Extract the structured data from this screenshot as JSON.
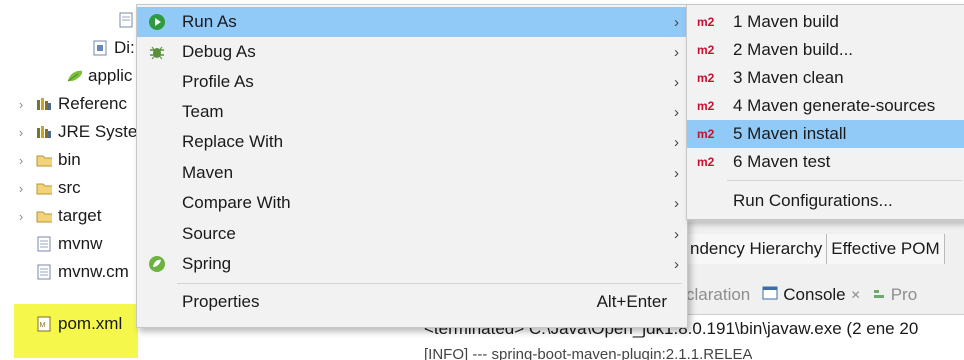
{
  "explorer": {
    "items": [
      {
        "label": "",
        "icon": "file-icon",
        "twisty": ""
      },
      {
        "label": "Di:",
        "icon": "class-file-icon",
        "twisty": ""
      },
      {
        "label": "applic",
        "icon": "leaf-icon",
        "twisty": ""
      },
      {
        "label": "Referenc",
        "icon": "library-icon",
        "twisty": "›"
      },
      {
        "label": "JRE Syste",
        "icon": "library-icon",
        "twisty": "›"
      },
      {
        "label": "bin",
        "icon": "folder-icon",
        "twisty": "›"
      },
      {
        "label": "src",
        "icon": "folder-icon",
        "twisty": "›"
      },
      {
        "label": "target",
        "icon": "folder-icon",
        "twisty": "›"
      },
      {
        "label": "mvnw",
        "icon": "text-file-icon",
        "twisty": ""
      },
      {
        "label": "mvnw.cm",
        "icon": "text-file-icon",
        "twisty": ""
      },
      {
        "label": "pom.xml",
        "icon": "xml-file-icon",
        "twisty": ""
      }
    ],
    "highlight_color": "#f5f84a"
  },
  "context_menu": {
    "items": [
      {
        "label": "Run As",
        "icon": "run-icon",
        "submenu": true,
        "active": true
      },
      {
        "label": "Debug As",
        "icon": "debug-bug-icon",
        "submenu": true
      },
      {
        "label": "Profile As",
        "icon": "",
        "submenu": true
      },
      {
        "label": "Team",
        "icon": "",
        "submenu": true
      },
      {
        "label": "Replace With",
        "icon": "",
        "submenu": true
      },
      {
        "label": "Maven",
        "icon": "",
        "submenu": true
      },
      {
        "label": "Compare With",
        "icon": "",
        "submenu": true
      },
      {
        "label": "Source",
        "icon": "",
        "submenu": true
      },
      {
        "label": "Spring",
        "icon": "spring-leaf-icon",
        "submenu": true
      },
      {
        "label": "Properties",
        "icon": "",
        "shortcut": "Alt+Enter"
      }
    ],
    "arrow": "›"
  },
  "run_as_submenu": {
    "badge": "m2",
    "items": [
      {
        "label": "1 Maven build"
      },
      {
        "label": "2 Maven build..."
      },
      {
        "label": "3 Maven clean"
      },
      {
        "label": "4 Maven generate-sources"
      },
      {
        "label": "5 Maven install",
        "active": true
      },
      {
        "label": "6 Maven test"
      }
    ],
    "run_configurations": "Run Configurations..."
  },
  "editor": {
    "pom_tabs": [
      "ndency Hierarchy",
      "Effective POM"
    ],
    "view_tabs": {
      "declaration": "claration",
      "console": "Console",
      "close": "✕",
      "progress": "Pro"
    },
    "console_line": "<terminated> C:\\Java\\Open_jdk1.8.0.191\\bin\\javaw.exe (2 ene 20",
    "console_line2": "[INFO] --- spring-boot-maven-plugin:2.1.1.RELEA"
  },
  "colors": {
    "menu_bg": "#f2f2f2",
    "menu_active": "#91c9f7",
    "m2_red": "#c8102e",
    "run_green": "#2e9b3e"
  }
}
